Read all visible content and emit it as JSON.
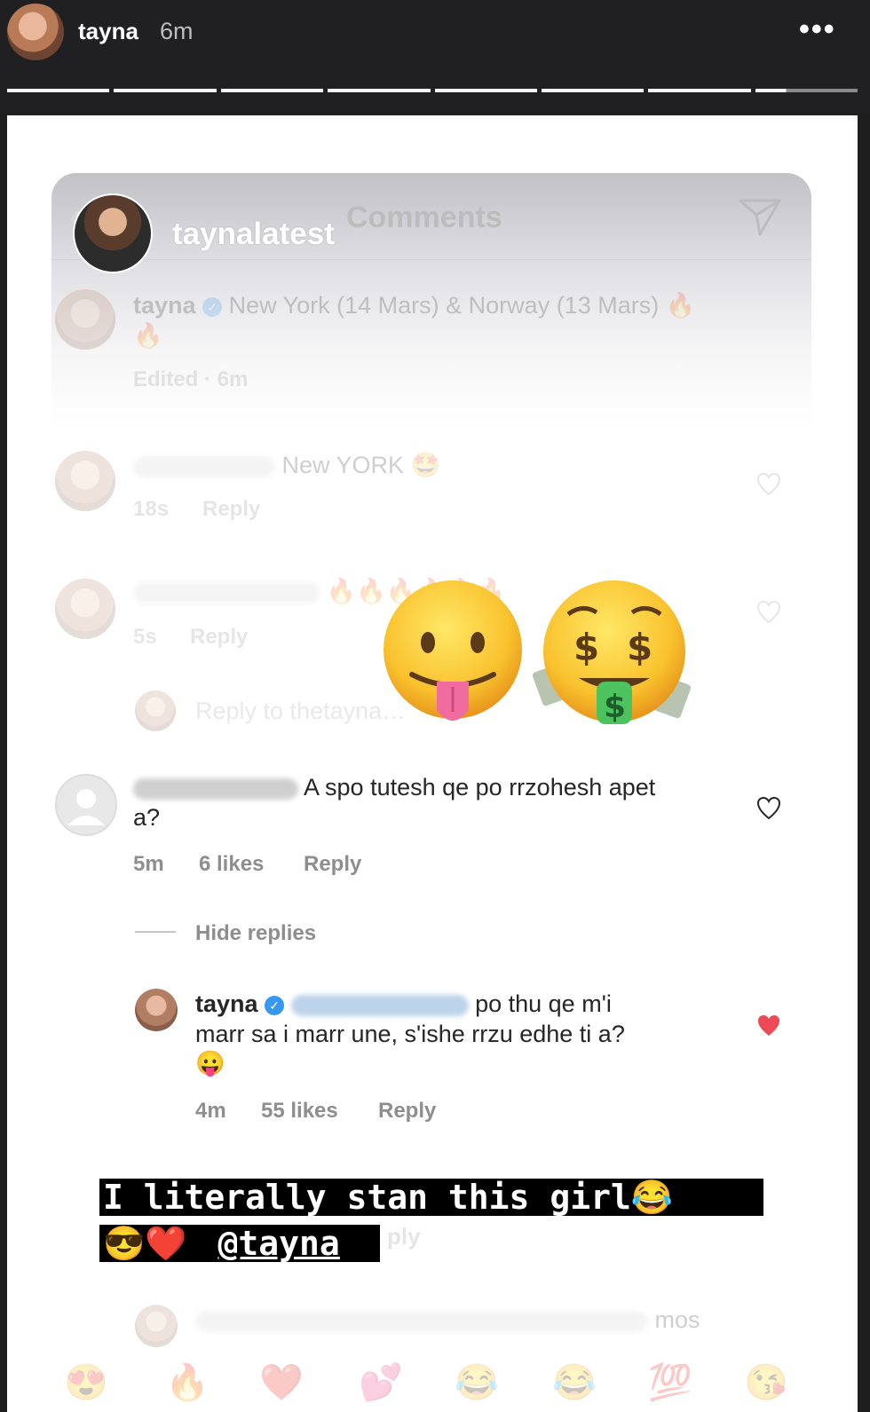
{
  "story": {
    "username": "tayna",
    "time": "6m",
    "more_label": "•••",
    "segments": 8
  },
  "overlay": {
    "account": "taynalatest",
    "title": "Comments"
  },
  "post": {
    "username": "tayna",
    "text": "New York (14 Mars) & Norway (13 Mars) 🔥",
    "text_line2": "🔥",
    "meta": "Edited · 6m"
  },
  "comments": [
    {
      "text": "New YORK 🤩",
      "time": "18s",
      "reply": "Reply"
    },
    {
      "text": "🔥🔥🔥🔥🔥🔥",
      "time": "5s",
      "reply": "Reply"
    },
    {
      "reply_to": "Reply to thetaynа…"
    },
    {
      "text": "A spo tutesh qe po rrzohesh apet",
      "text_line2": "a?",
      "time": "5m",
      "likes": "6 likes",
      "reply": "Reply",
      "hide_replies": "Hide replies"
    }
  ],
  "reply": {
    "username": "tayna",
    "text": "po thu qe m'i",
    "text_line2": "marr sa i marr une, s'ishe rrzu edhe ti a?",
    "emoji": "😛",
    "time": "4m",
    "likes": "55 likes",
    "reply": "Reply"
  },
  "caption": {
    "line1": "I literally stan this girl",
    "line1_emoji": "😂",
    "line2_emoji": "😎❤️",
    "mention": "@tayna"
  },
  "stickers": {
    "first": "tongue-out-emoji",
    "second": "money-mouth-emoji"
  },
  "bottom": {
    "partial": "mos"
  },
  "reactions": [
    "😍",
    "🔥",
    "❤️",
    "💕",
    "😂",
    "😂",
    "💯",
    "😘"
  ],
  "colors": {
    "heart_liked": "#ed4956",
    "verified": "#3897f0"
  }
}
